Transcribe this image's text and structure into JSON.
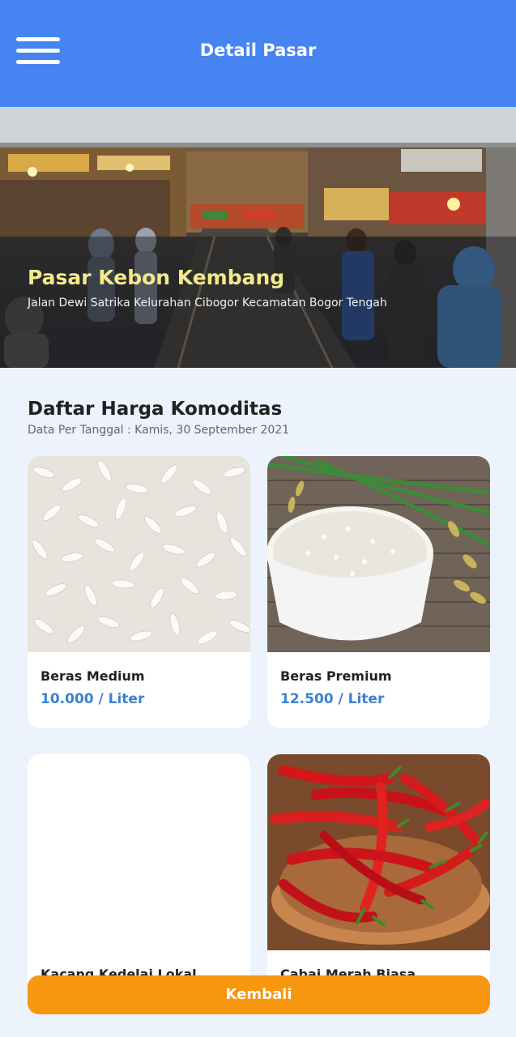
{
  "app": {
    "title": "Detail Pasar"
  },
  "market": {
    "name": "Pasar Kebon Kembang",
    "address": "Jalan Dewi Satrika Kelurahan Cibogor Kecamatan Bogor Tengah"
  },
  "prices": {
    "heading": "Daftar Harga Komoditas",
    "date_label": "Data Per Tanggal : Kamis, 30 September 2021",
    "items": [
      {
        "name": "Beras Medium",
        "price": "10.000 / Liter"
      },
      {
        "name": "Beras Premium",
        "price": "12.500 / Liter"
      },
      {
        "name": "Kacang Kedelai Lokal",
        "price": ""
      },
      {
        "name": "Cabai Merah Biasa",
        "price": ""
      }
    ]
  },
  "footer": {
    "back_label": "Kembali"
  },
  "colors": {
    "appbar": "#4584f1",
    "accent": "#f7960f",
    "price": "#3d7fd0",
    "market_name": "#f4ea8a"
  }
}
